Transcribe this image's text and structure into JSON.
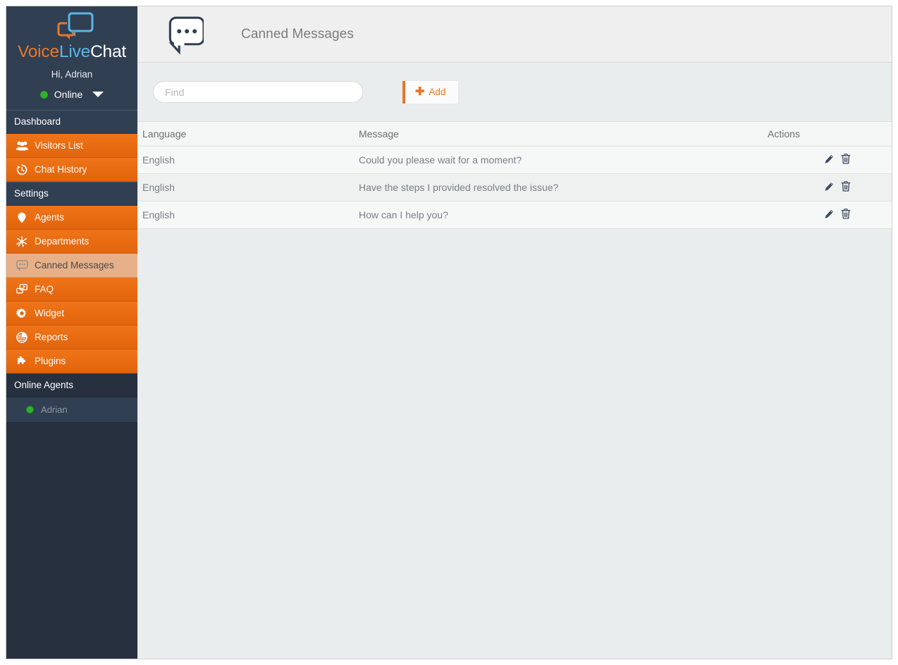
{
  "brand": {
    "logo_icon": "chat-bubbles-logo-icon",
    "word_voice": "Voice",
    "word_live": "Live",
    "word_chat": "Chat",
    "greeting": "Hi, Adrian",
    "status_label": "Online",
    "status_color": "#2fb02f",
    "caret_icon": "chevron-down-icon"
  },
  "sidebar": {
    "sections": [
      {
        "type": "section",
        "label": "Dashboard",
        "style": "light"
      },
      {
        "type": "item",
        "label": "Visitors List",
        "icon": "users-group-icon",
        "active": false
      },
      {
        "type": "item",
        "label": "Chat History",
        "icon": "clock-history-icon",
        "active": false
      },
      {
        "type": "section",
        "label": "Settings",
        "style": "light"
      },
      {
        "type": "item",
        "label": "Agents",
        "icon": "agent-headset-icon",
        "active": false
      },
      {
        "type": "item",
        "label": "Departments",
        "icon": "departments-network-icon",
        "active": false
      },
      {
        "type": "item",
        "label": "Canned Messages",
        "icon": "speech-bubble-dots-icon",
        "active": true
      },
      {
        "type": "item",
        "label": "FAQ",
        "icon": "faq-bubble-icon",
        "active": false
      },
      {
        "type": "item",
        "label": "Widget",
        "icon": "gear-icon",
        "active": false
      },
      {
        "type": "item",
        "label": "Reports",
        "icon": "pie-chart-icon",
        "active": false
      },
      {
        "type": "item",
        "label": "Plugins",
        "icon": "puzzle-piece-icon",
        "active": false
      },
      {
        "type": "section",
        "label": "Online Agents",
        "style": "dark"
      }
    ],
    "online_agents": [
      {
        "name": "Adrian",
        "status_color": "#2fb02f"
      }
    ]
  },
  "header": {
    "icon": "speech-bubble-dots-icon",
    "title": "Canned Messages"
  },
  "toolbar": {
    "find_placeholder": "Find",
    "find_value": "",
    "add_label": "Add",
    "add_icon": "plus-icon"
  },
  "table": {
    "columns": [
      {
        "key": "language",
        "label": "Language"
      },
      {
        "key": "message",
        "label": "Message"
      },
      {
        "key": "actions",
        "label": "Actions"
      }
    ],
    "rows": [
      {
        "language": "English",
        "message": "Could you please wait for a moment?",
        "edit_icon": "pencil-icon",
        "delete_icon": "trash-icon"
      },
      {
        "language": "English",
        "message": "Have the steps I provided resolved the issue?",
        "edit_icon": "pencil-icon",
        "delete_icon": "trash-icon"
      },
      {
        "language": "English",
        "message": "How can I help you?",
        "edit_icon": "pencil-icon",
        "delete_icon": "trash-icon"
      }
    ]
  },
  "colors": {
    "accent_orange": "#e8772a",
    "sidebar_navy": "#313f52",
    "sidebar_navy_dark": "#26303e",
    "active_item_tan": "#e7b088",
    "content_bg": "#e9eded",
    "header_bg": "#efefef"
  }
}
